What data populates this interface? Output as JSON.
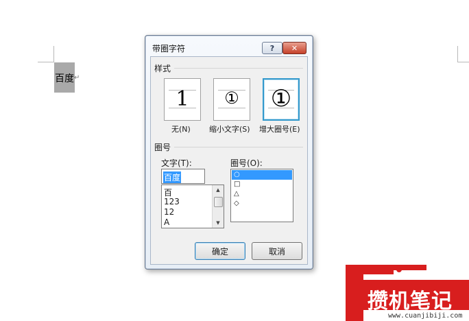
{
  "document": {
    "selected_text": "百度",
    "paragraph_mark": "↵"
  },
  "dialog": {
    "title": "带圈字符",
    "help_label": "?",
    "close_label": "✕",
    "style_group_label": "样式",
    "styles": [
      {
        "glyph": "1",
        "caption": "无(N)"
      },
      {
        "glyph": "①",
        "caption": "缩小文字(S)"
      },
      {
        "glyph": "①",
        "caption": "增大圈号(E)"
      }
    ],
    "selected_style": "增大圈号(E)",
    "circle_group_label": "圈号",
    "text_label": "文字(T):",
    "text_value": "百度",
    "text_list": [
      "百",
      "123",
      "12",
      "A"
    ],
    "shape_label": "圈号(O):",
    "shape_list": [
      "○",
      "□",
      "△",
      "◇"
    ],
    "selected_shape": "○",
    "ok_label": "确定",
    "cancel_label": "取消"
  },
  "watermark": {
    "brand": "攒机笔记",
    "url": "www.cuanjibiji.com"
  },
  "colors": {
    "selection_blue": "#3399ff",
    "watermark_red": "#d81e1e"
  }
}
